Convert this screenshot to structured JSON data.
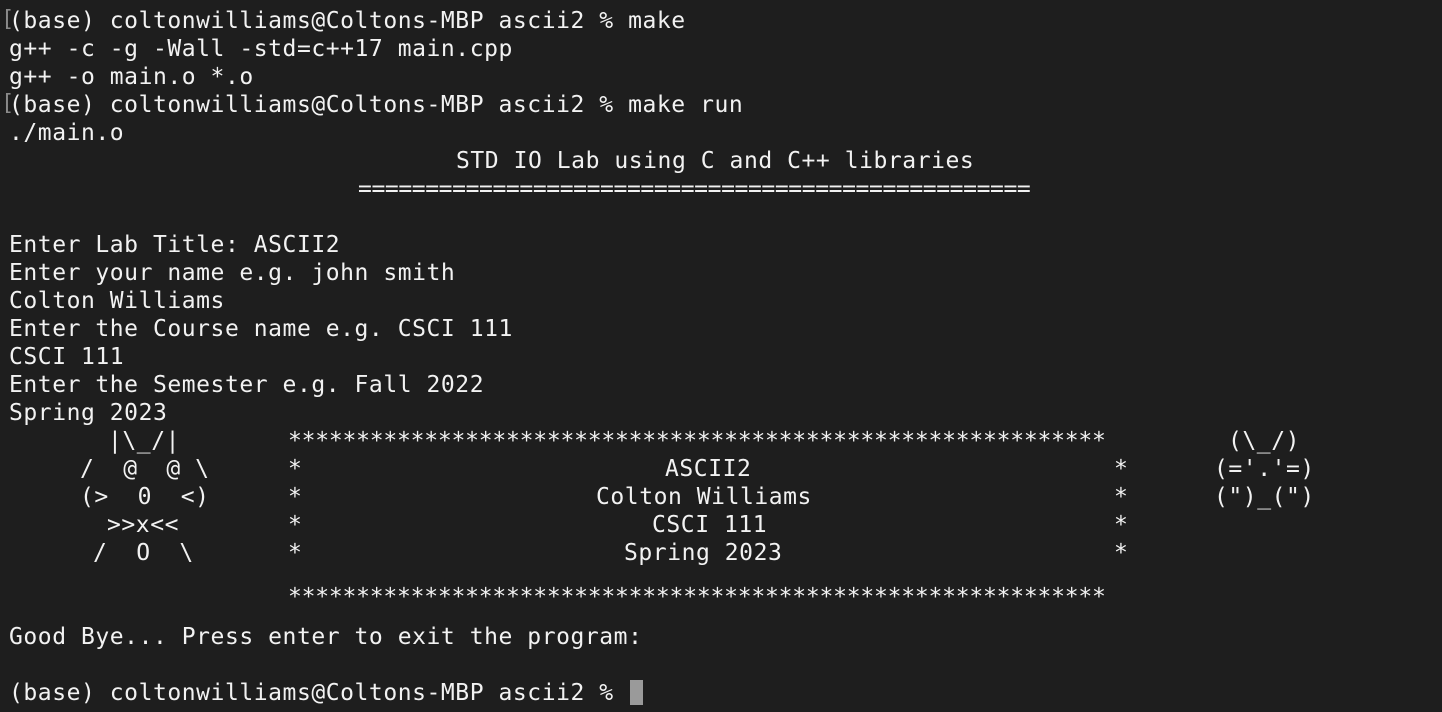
{
  "terminal": {
    "bracket_mark": "[",
    "lines": {
      "l1": "(base) coltonwilliams@Coltons-MBP ascii2 % make",
      "l2": "g++ -c -g -Wall -std=c++17 main.cpp",
      "l3": "g++ -o main.o *.o",
      "l4": "(base) coltonwilliams@Coltons-MBP ascii2 % make run",
      "l5": "./main.o",
      "l6": "STD IO Lab using C and C++ libraries",
      "l7": "==================================================",
      "l8": "Enter Lab Title: ASCII2",
      "l9": "Enter your name e.g. john smith",
      "l10": "Colton Williams",
      "l11": "Enter the Course name e.g. CSCI 111",
      "l12": "CSCI 111",
      "l13": "Enter the Semester e.g. Fall 2022",
      "l14": "Spring 2023",
      "l21": "Good Bye... Press enter to exit the program:",
      "l22": "(base) coltonwilliams@Coltons-MBP ascii2 %"
    },
    "ascii_left": [
      "|\\_/|",
      "/  @  @ \\",
      "(>  0  <)",
      ">>x<<",
      "/  O  \\"
    ],
    "box": {
      "border": "************************************************************",
      "side": "*",
      "rows": [
        "ASCII2",
        "Colton Williams",
        "CSCI 111",
        "Spring 2023"
      ]
    },
    "ascii_right": [
      "(\\_/)",
      "(='.'=)",
      "(\")_(\")"
    ]
  },
  "colors": {
    "background": "#1e1e1e",
    "text": "#f2f2f2",
    "cursor": "#9a9a9a"
  }
}
